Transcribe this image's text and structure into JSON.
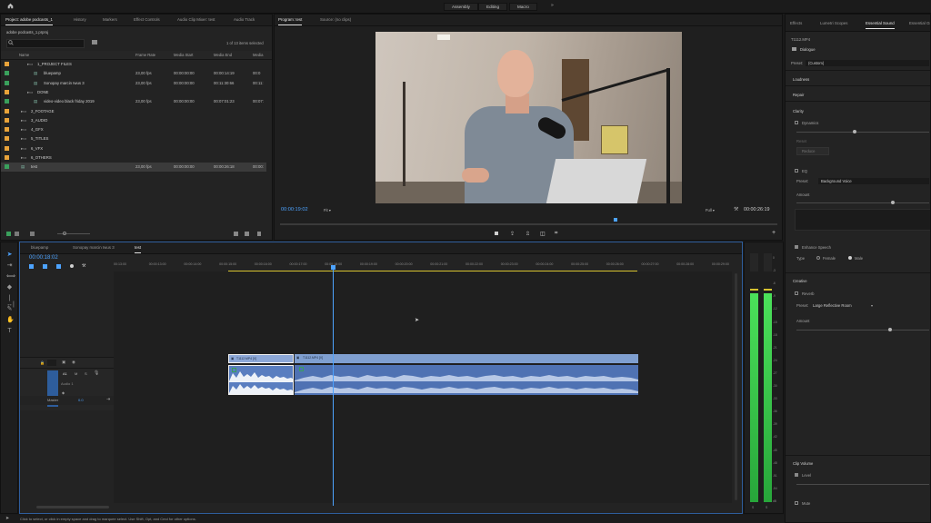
{
  "workspaces": {
    "items": [
      "Assembly",
      "Editing",
      "Macro"
    ]
  },
  "project": {
    "tabs": [
      "Project: adobe podcasts_1",
      "History",
      "Markers",
      "Effect Controls",
      "Audio Clip Mixer: test",
      "Audio Track"
    ],
    "filename": "adobe podcasts_1.prproj",
    "items_selected": "1 of 13 items selected",
    "columns": [
      "Name",
      "Frame Rate",
      "Media Start",
      "Media End",
      "Media"
    ],
    "rows": [
      {
        "name": "1_PROJECT FILES",
        "fps": "",
        "start": "",
        "end": "",
        "dur": "",
        "color": "#e8a33a"
      },
      {
        "name": "bluepamp",
        "fps": "23,00 fps",
        "start": "00:00:00:00",
        "end": "00:00:14:19",
        "dur": "00:0",
        "color": "#3aa05c"
      },
      {
        "name": "Sonopay marcin Iwus 3",
        "fps": "23,00 fps",
        "start": "00:00:00:00",
        "end": "00:11:30:66",
        "dur": "00:11:",
        "color": "#3aa05c"
      },
      {
        "name": "DONE",
        "fps": "",
        "start": "",
        "end": "",
        "dur": "",
        "color": "#e8a33a"
      },
      {
        "name": "video-video black friday 2019",
        "fps": "23,00 fps",
        "start": "00:00:00:00",
        "end": "00:07:01:23",
        "dur": "00:07:",
        "color": "#3aa05c"
      },
      {
        "name": "2_FOOTAGE",
        "fps": "",
        "start": "",
        "end": "",
        "dur": "",
        "color": "#e8a33a"
      },
      {
        "name": "3_AUDIO",
        "fps": "",
        "start": "",
        "end": "",
        "dur": "",
        "color": "#e8a33a"
      },
      {
        "name": "4_GFX",
        "fps": "",
        "start": "",
        "end": "",
        "dur": "",
        "color": "#e8a33a"
      },
      {
        "name": "5_TITLES",
        "fps": "",
        "start": "",
        "end": "",
        "dur": "",
        "color": "#e8a33a"
      },
      {
        "name": "6_VFX",
        "fps": "",
        "start": "",
        "end": "",
        "dur": "",
        "color": "#e8a33a"
      },
      {
        "name": "6_OTHERS",
        "fps": "",
        "start": "",
        "end": "",
        "dur": "",
        "color": "#e8a33a"
      },
      {
        "name": "test",
        "fps": "23,00 fps",
        "start": "00:00:00:00",
        "end": "00:00:26:18",
        "dur": "00:00:",
        "color": "#3aa05c"
      }
    ]
  },
  "program": {
    "tabs": [
      "Program: test",
      "Source: (no clips)"
    ],
    "timecode": "00:00:19:02",
    "fit": "Fit",
    "quality": "Full",
    "duration": "00:00:26:19"
  },
  "timeline": {
    "tabs": [
      "bluepamp",
      "Sonopay marcin Iwus 3",
      "test"
    ],
    "timecode": "00:00:18:02",
    "ruler": [
      "00:13:00",
      "00:00:13:00",
      "00:00:14:00",
      "00:00:15:00",
      "00:00:16:00",
      "00:00:17:00",
      "00:00:18:00",
      "00:00:19:00",
      "00:00:20:00",
      "00:00:21:00",
      "00:00:22:00",
      "00:00:23:00",
      "00:00:24:00",
      "00:00:25:00",
      "00:00:26:00",
      "00:00:27:00",
      "00:00:28:00",
      "00:00:29:00"
    ],
    "track_v1": "V1",
    "track_a1": "A1",
    "track_a1_name": "Audio 1",
    "track_master": "Master",
    "master_value": "0.0",
    "clip1": "T1112.MP4 [V]",
    "clip2": "T1112.MP4 [V]"
  },
  "meter": {
    "labels": [
      "0",
      "-3",
      "-6",
      "-9",
      "-12",
      "-15",
      "-18",
      "-21",
      "-24",
      "-27",
      "-30",
      "-33",
      "-36",
      "-39",
      "-42",
      "-45",
      "-48",
      "-51",
      "-54",
      "dB"
    ],
    "foot": [
      "S",
      "S"
    ]
  },
  "essential_sound": {
    "tabs": [
      "Effects",
      "Lumetri Scopes",
      "Essential Sound",
      "Essential Gr"
    ],
    "clip_name": "T1112.MP4",
    "type": "Dialogue",
    "preset_label": "Preset:",
    "preset_value": "(Custom)",
    "sections": {
      "loudness": "Loudness",
      "repair": "Repair",
      "clarity": "Clarity",
      "dynamics": "Dynamics",
      "reset": "Reset",
      "reduce": "Reduce",
      "eq": "EQ",
      "eq_preset": "Background Voice",
      "amount": "Amount",
      "enhance": "Enhance Speech",
      "type_label": "Type",
      "female": "Female",
      "male": "Male",
      "creative": "Creative",
      "reverb": "Reverb",
      "reverb_preset": "Large Reflective Room",
      "clip_volume": "Clip Volume",
      "level": "Level",
      "mute": "Mute"
    }
  },
  "status": "Click to select, or click in empty space and drag to marquee select. Use Shift, Opt, and Cmd for other options."
}
